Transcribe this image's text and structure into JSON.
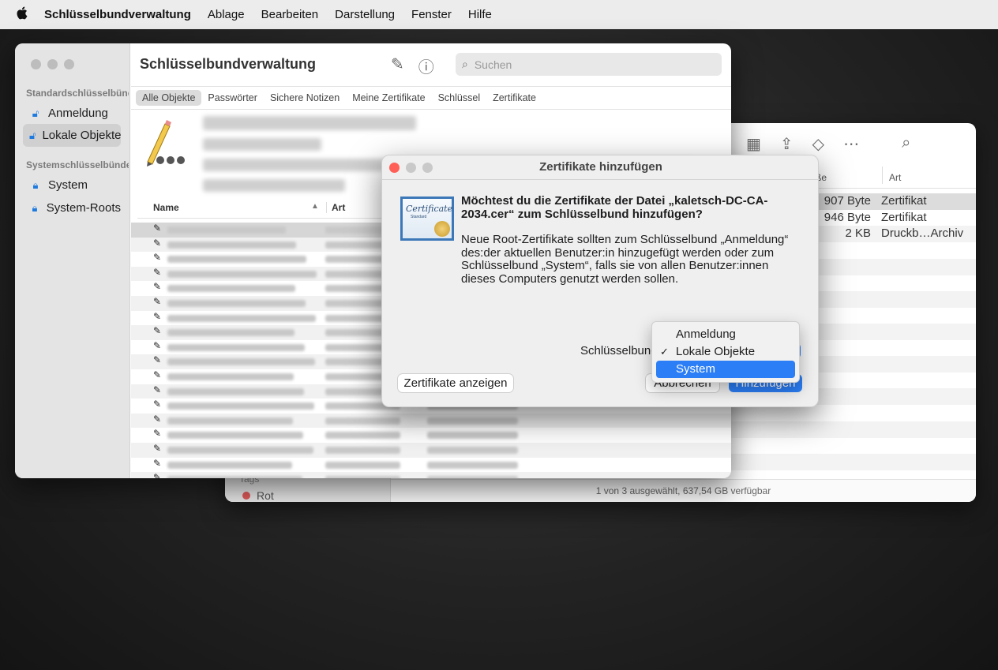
{
  "menubar": {
    "app": "Schlüsselbundverwaltung",
    "items": [
      "Ablage",
      "Bearbeiten",
      "Darstellung",
      "Fenster",
      "Hilfe"
    ]
  },
  "finder": {
    "column_size": "ße",
    "column_kind": "Art",
    "rows": [
      {
        "size": "907 Byte",
        "kind": "Zertifikat"
      },
      {
        "size": "946 Byte",
        "kind": "Zertifikat"
      },
      {
        "size": "2 KB",
        "kind": "Druckb…Archiv"
      }
    ],
    "tags_label": "Tags",
    "tag_red": "Rot",
    "status": "1 von 3 ausgewählt, 637,54 GB verfügbar"
  },
  "keychain": {
    "title": "Schlüsselbundverwaltung",
    "search_placeholder": "Suchen",
    "sidebar": {
      "section_default": "Standardschlüsselbünde",
      "anmeldung": "Anmeldung",
      "lokale": "Lokale Objekte",
      "section_system": "Systemschlüsselbünde",
      "system": "System",
      "system_roots": "System-Roots"
    },
    "tabs": [
      "Alle Objekte",
      "Passwörter",
      "Sichere Notizen",
      "Meine Zertifikate",
      "Schlüssel",
      "Zertifikate"
    ],
    "list_header": {
      "name": "Name",
      "kind": "Art"
    }
  },
  "dialog": {
    "title": "Zertifikate hinzufügen",
    "question": "Möchtest du die Zertifikate der Datei „kaletsch-DC-CA-2034.cer“ zum Schlüsselbund hinzufügen?",
    "body": "Neue Root-Zertifikate sollten zum Schlüsselbund „Anmeldung“ des:der aktuellen Benutzer:in hinzugefügt werden oder zum Schlüsselbund „System“, falls sie von allen Benutzer:innen dieses Computers genutzt werden sollen.",
    "keychain_label": "Schlüsselbund:",
    "show_button": "Zertifikate anzeigen",
    "cancel_button": "Abbrechen",
    "add_button": "Hinzufügen",
    "cert_image_text": "Certificate",
    "cert_image_subtext": "Standard"
  },
  "popup_menu": {
    "options": [
      "Anmeldung",
      "Lokale Objekte",
      "System"
    ],
    "checked": "Lokale Objekte",
    "highlighted": "System"
  },
  "colors": {
    "accent": "#2b7ef5",
    "close": "#ff5f57"
  }
}
